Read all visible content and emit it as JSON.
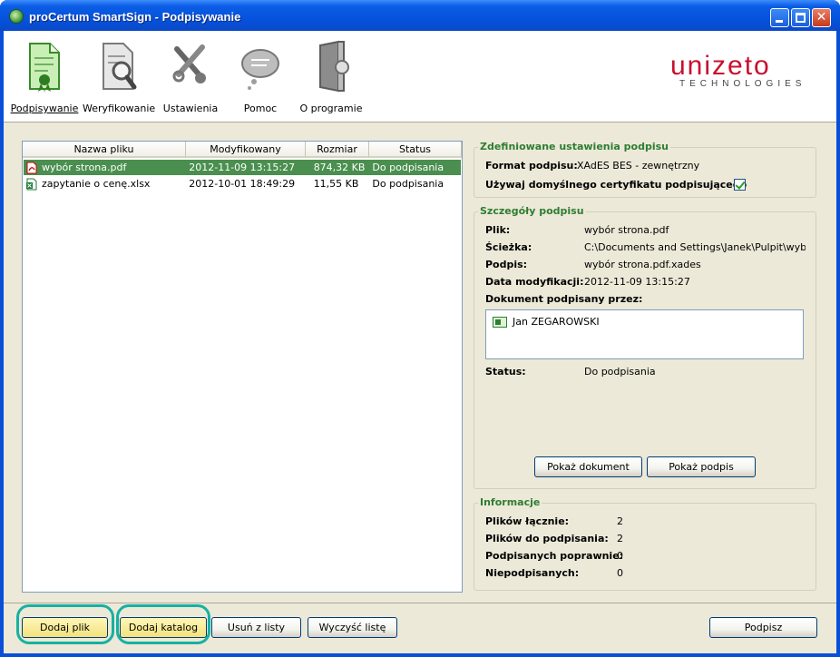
{
  "window": {
    "title": "proCertum SmartSign - Podpisywanie"
  },
  "toolbar": {
    "items": [
      {
        "label": "Podpisywanie",
        "icon": "sign-document-icon"
      },
      {
        "label": "Weryfikowanie",
        "icon": "verify-magnifier-icon"
      },
      {
        "label": "Ustawienia",
        "icon": "tools-icon"
      },
      {
        "label": "Pomoc",
        "icon": "help-bubble-icon"
      },
      {
        "label": "O programie",
        "icon": "about-door-icon"
      }
    ]
  },
  "logo": {
    "word": "unizeto",
    "sub": "TECHNOLOGIES"
  },
  "filelist": {
    "columns": [
      "Nazwa pliku",
      "Modyfikowany",
      "Rozmiar",
      "Status"
    ],
    "rows": [
      {
        "name": "wybór strona.pdf",
        "modified": "2012-11-09 13:15:27",
        "size": "874,32 KB",
        "status": "Do podpisania",
        "type": "pdf",
        "selected": true
      },
      {
        "name": "zapytanie o cenę.xlsx",
        "modified": "2012-10-01 18:49:29",
        "size": "11,55 KB",
        "status": "Do podpisania",
        "type": "xlsx",
        "selected": false
      }
    ]
  },
  "settings": {
    "legend": "Zdefiniowane ustawienia podpisu",
    "format_label": "Format podpisu:",
    "format_value": "XAdES BES - zewnętrzny",
    "default_cert_label": "Używaj domyślnego certyfikatu podpisującego",
    "default_cert_checked": true
  },
  "details": {
    "legend": "Szczegóły podpisu",
    "file_label": "Plik:",
    "file_value": "wybór strona.pdf",
    "path_label": "Ścieżka:",
    "path_value": "C:\\Documents and Settings\\Janek\\Pulpit\\wybór str",
    "signature_label": "Podpis:",
    "signature_value": "wybór strona.pdf.xades",
    "modified_label": "Data modyfikacji:",
    "modified_value": "2012-11-09 13:15:27",
    "signed_by_label": "Dokument podpisany przez:",
    "signers": [
      "Jan ZEGAROWSKI"
    ],
    "status_label": "Status:",
    "status_value": "Do podpisania",
    "show_document": "Pokaż dokument",
    "show_signature": "Pokaż podpis"
  },
  "info": {
    "legend": "Informacje",
    "total_label": "Plików łącznie:",
    "total_value": "2",
    "to_sign_label": "Plików do podpisania:",
    "to_sign_value": "2",
    "signed_ok_label": "Podpisanych poprawnie:",
    "signed_ok_value": "0",
    "unsigned_label": "Niepodpisanych:",
    "unsigned_value": "0"
  },
  "bottom": {
    "add_file": "Dodaj plik",
    "add_folder": "Dodaj katalog",
    "remove": "Usuń z listy",
    "clear": "Wyczyść listę",
    "sign": "Podpisz"
  },
  "colors": {
    "accent_green": "#2e7d32",
    "selection": "#4a8f4f",
    "highlight": "#16b1a3",
    "brand_red": "#c8102e"
  }
}
